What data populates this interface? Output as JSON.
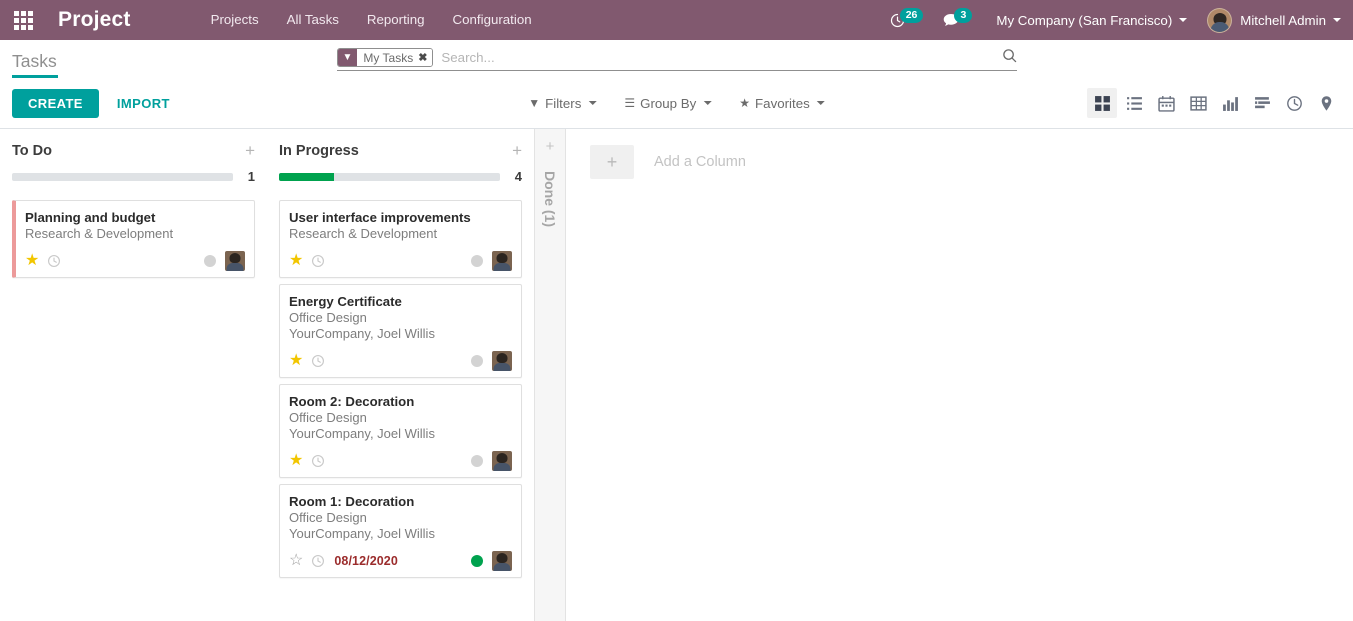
{
  "navbar": {
    "apps_icon": "apps-grid-icon",
    "brand": "Project",
    "menu": [
      {
        "label": "Projects"
      },
      {
        "label": "All Tasks"
      },
      {
        "label": "Reporting"
      },
      {
        "label": "Configuration"
      }
    ],
    "activity_icon": "clock-activity-icon",
    "activity_count": "26",
    "messaging_icon": "chat-bubble-icon",
    "messaging_count": "3",
    "company": "My Company (San Francisco)",
    "user_name": "Mitchell Admin",
    "user_avatar": "user-avatar",
    "bg_color": "#81596f",
    "badge_color": "#00a09d"
  },
  "control_panel": {
    "page_title": "Tasks",
    "accent_color": "#00a09d",
    "search": {
      "facet_icon": "filter-funnel-icon",
      "facet_label": "My Tasks",
      "facet_remove_icon": "close-x-icon",
      "placeholder": "Search...",
      "value": "",
      "search_icon": "magnifier-icon"
    },
    "create_label": "CREATE",
    "import_label": "IMPORT",
    "dropdowns": [
      {
        "label": "Filters",
        "icon": "filter-funnel-icon"
      },
      {
        "label": "Group By",
        "icon": "bars-icon"
      },
      {
        "label": "Favorites",
        "icon": "star-icon"
      }
    ],
    "views": [
      {
        "name": "kanban",
        "icon": "kanban-view-icon",
        "active": true
      },
      {
        "name": "list",
        "icon": "list-view-icon",
        "active": false
      },
      {
        "name": "calendar",
        "icon": "calendar-view-icon",
        "active": false
      },
      {
        "name": "pivot",
        "icon": "pivot-view-icon",
        "active": false
      },
      {
        "name": "graph",
        "icon": "graph-view-icon",
        "active": false
      },
      {
        "name": "gantt",
        "icon": "gantt-view-icon",
        "active": false
      },
      {
        "name": "activity",
        "icon": "activity-clock-view-icon",
        "active": false
      },
      {
        "name": "map",
        "icon": "map-pin-view-icon",
        "active": false
      }
    ]
  },
  "kanban": {
    "columns": [
      {
        "title": "To Do",
        "count": "1",
        "progress_percent": 0,
        "progress_color": "#00a24e",
        "add_icon": "plus-icon",
        "cards": [
          {
            "title": "Planning and budget",
            "project": "Research & Development",
            "customer": "",
            "stripe": true,
            "stripe_color": "#ec9a9a",
            "starred": true,
            "star_icon": "star-filled-icon",
            "clock_icon": "clock-icon",
            "deadline": "",
            "state_color": "#d3d3d3",
            "avatar": "assignee-avatar"
          }
        ]
      },
      {
        "title": "In Progress",
        "count": "4",
        "progress_percent": 25,
        "progress_color": "#00a24e",
        "add_icon": "plus-icon",
        "cards": [
          {
            "title": "User interface improvements",
            "project": "Research & Development",
            "customer": "",
            "stripe": false,
            "stripe_color": "",
            "starred": true,
            "star_icon": "star-filled-icon",
            "clock_icon": "clock-icon",
            "deadline": "",
            "state_color": "#d3d3d3",
            "avatar": "assignee-avatar"
          },
          {
            "title": "Energy Certificate",
            "project": "Office Design",
            "customer": "YourCompany, Joel Willis",
            "stripe": false,
            "stripe_color": "",
            "starred": true,
            "star_icon": "star-filled-icon",
            "clock_icon": "clock-icon",
            "deadline": "",
            "state_color": "#d3d3d3",
            "avatar": "assignee-avatar"
          },
          {
            "title": "Room 2: Decoration",
            "project": "Office Design",
            "customer": "YourCompany, Joel Willis",
            "stripe": false,
            "stripe_color": "",
            "starred": true,
            "star_icon": "star-filled-icon",
            "clock_icon": "clock-icon",
            "deadline": "",
            "state_color": "#d3d3d3",
            "avatar": "assignee-avatar"
          },
          {
            "title": "Room 1: Decoration",
            "project": "Office Design",
            "customer": "YourCompany, Joel Willis",
            "stripe": false,
            "stripe_color": "",
            "starred": false,
            "star_icon": "star-outline-icon",
            "clock_icon": "clock-icon",
            "deadline": "08/12/2020",
            "deadline_color": "#9b2c2c",
            "state_color": "#00a24e",
            "avatar": "assignee-avatar"
          }
        ]
      }
    ],
    "folded_column": {
      "title": "Done (1)",
      "add_icon": "plus-icon"
    },
    "add_column": {
      "icon": "plus-icon",
      "label": "Add a Column"
    }
  }
}
